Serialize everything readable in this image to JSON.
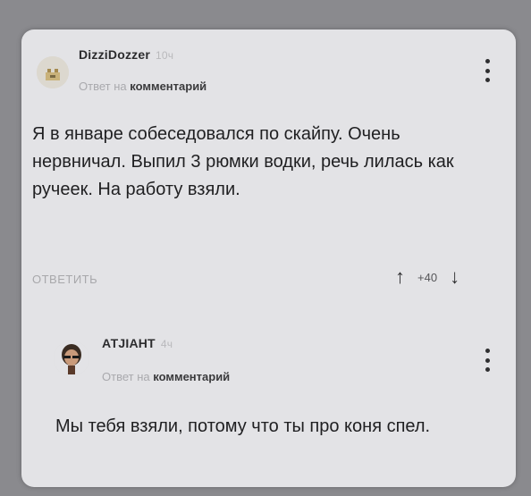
{
  "comments": [
    {
      "username": "DizziDozzer",
      "time": "10ч",
      "reply_prefix": "Ответ на",
      "reply_target": "комментарий",
      "text": "Я в январе собеседовался по скайпу. Очень нервничал. Выпил 3 рюмки водки, речь лилась как ручеек. На работу взяли.",
      "reply_label": "ОТВЕТИТЬ",
      "score": "+40",
      "upvote_icon": "arrow-up-icon",
      "downvote_icon": "arrow-down-icon"
    },
    {
      "username": "АТЈІАНТ",
      "time": "4ч",
      "reply_prefix": "Ответ на",
      "reply_target": "комментарий",
      "text": "Мы тебя взяли, потому что ты про коня спел."
    }
  ],
  "colors": {
    "background": "#8a8a8e",
    "card": "#e3e3e6",
    "text": "#1f1f21",
    "muted": "#a9a9ad"
  }
}
